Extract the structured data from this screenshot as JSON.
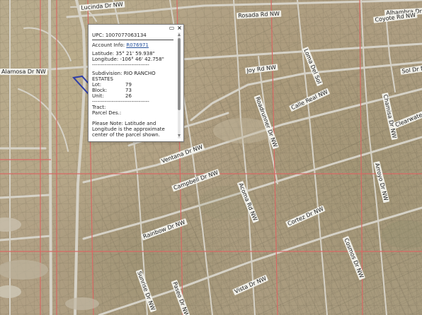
{
  "map": {
    "road_labels": [
      "Lucinda Dr NW",
      "Rosada Rd NW",
      "Alhambra Dr NW",
      "Alamosa Dr NW",
      "Coyote Rd NW",
      "Joy Rd NW",
      "Loma Del Sol",
      "Sol Dr NW",
      "Roadrunner Dr NW",
      "Chamisa Dr NW",
      "Calle Real NW",
      "Clearwater Dr NW",
      "Ventana Dr NW",
      "Acoma Rd NW",
      "Campbell Dr NW",
      "Rainbow Dr NW",
      "Cortez Dr NW",
      "Cosmos Dr NW",
      "Arroyo Dr NW",
      "Sunrise Dr NW",
      "Paseo Dr NW",
      "Vista Dr NW"
    ],
    "lot_colors": {
      "road": "#d7d3cb",
      "red_line": "#d56c67",
      "blue_line": "#2f3ea8"
    }
  },
  "popup": {
    "upc_label": "UPC:",
    "upc_value": "1007077063134",
    "account_info_label": "Account Info:",
    "account_info_value": "R076971",
    "latitude_label": "Latitude:",
    "latitude_value": "35° 21' 59.938\"",
    "longitude_label": "Longitude:",
    "longitude_value": "-106° 46' 42.758\"",
    "divider_text": "--------------------------------",
    "subdivision_label": "Subdivision:",
    "subdivision_value": "RIO RANCHO ESTATES",
    "lot_label": "Lot:",
    "lot_value": "79",
    "block_label": "Block:",
    "block_value": "73",
    "unit_label": "Unit:",
    "unit_value": "26",
    "tract_label": "Tract:",
    "parcel_desc_label": "Parcel Des.:",
    "note": "Please Note: Latitude and Longitude is the approximate center of the parcel shown."
  },
  "icons": {
    "minimize": "minimize-icon",
    "close": "close-icon",
    "scroll_up": "chevron-up-icon",
    "scroll_down": "chevron-down-icon"
  }
}
